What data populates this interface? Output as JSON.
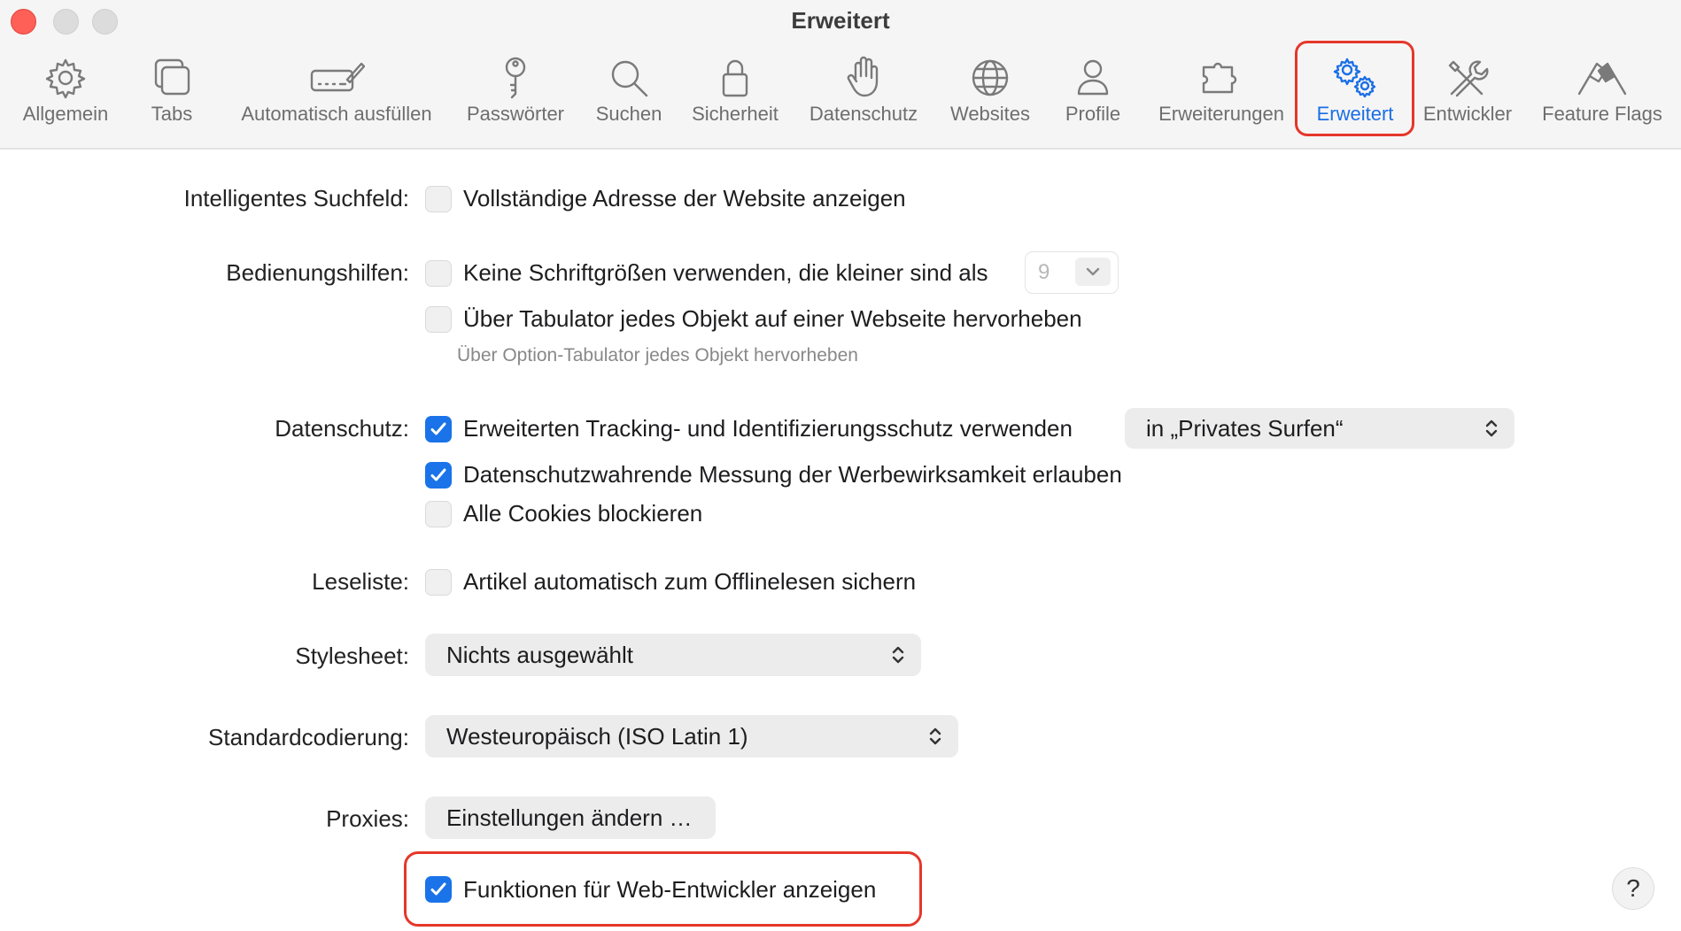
{
  "window": {
    "title": "Erweitert"
  },
  "toolbar": {
    "tabs": [
      {
        "label": "Allgemein",
        "icon": "gear-icon"
      },
      {
        "label": "Tabs",
        "icon": "tabs-icon"
      },
      {
        "label": "Automatisch ausfüllen",
        "icon": "autofill-icon"
      },
      {
        "label": "Passwörter",
        "icon": "key-icon"
      },
      {
        "label": "Suchen",
        "icon": "magnifier-icon"
      },
      {
        "label": "Sicherheit",
        "icon": "lock-icon"
      },
      {
        "label": "Datenschutz",
        "icon": "hand-icon"
      },
      {
        "label": "Websites",
        "icon": "globe-icon"
      },
      {
        "label": "Profile",
        "icon": "person-icon"
      },
      {
        "label": "Erweiterungen",
        "icon": "puzzle-icon"
      },
      {
        "label": "Erweitert",
        "icon": "gears-icon",
        "active": true
      },
      {
        "label": "Entwickler",
        "icon": "tools-icon"
      },
      {
        "label": "Feature Flags",
        "icon": "flags-icon"
      }
    ],
    "accent_color": "#1a6fe6",
    "highlight_color": "#e5372a"
  },
  "settings": {
    "smart_search": {
      "label": "Intelligentes Suchfeld:",
      "option": "Vollständige Adresse der Website anzeigen",
      "checked": false
    },
    "accessibility": {
      "label": "Bedienungshilfen:",
      "min_font_option": "Keine Schriftgrößen verwenden, die kleiner sind als",
      "min_font_checked": false,
      "min_font_value": "9",
      "tab_option": "Über Tabulator jedes Objekt auf einer Webseite hervorheben",
      "tab_checked": false,
      "tab_hint": "Über Option-Tabulator jedes Objekt hervorheben"
    },
    "privacy": {
      "label": "Datenschutz:",
      "tracking_option": "Erweiterten Tracking- und Identifizierungsschutz verwenden",
      "tracking_checked": true,
      "tracking_select": "in „Privates Surfen“",
      "ad_option": "Datenschutzwahrende Messung der Werbewirksamkeit erlauben",
      "ad_checked": true,
      "cookies_option": "Alle Cookies blockieren",
      "cookies_checked": false
    },
    "reading_list": {
      "label": "Leseliste:",
      "option": "Artikel automatisch zum Offlinelesen sichern",
      "checked": false
    },
    "stylesheet": {
      "label": "Stylesheet:",
      "value": "Nichts ausgewählt"
    },
    "encoding": {
      "label": "Standardcodierung:",
      "value": "Westeuropäisch (ISO Latin 1)"
    },
    "proxies": {
      "label": "Proxies:",
      "button": "Einstellungen ändern …"
    },
    "developer": {
      "option": "Funktionen für Web-Entwickler anzeigen",
      "checked": true
    }
  },
  "help": {
    "label": "?"
  }
}
